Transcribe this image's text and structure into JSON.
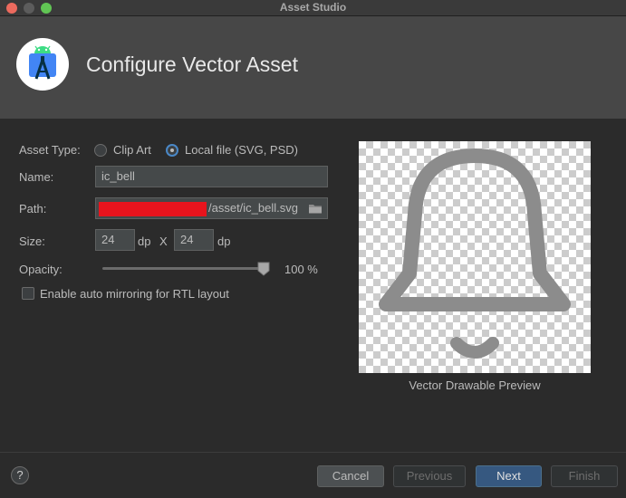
{
  "window": {
    "title": "Asset Studio"
  },
  "header": {
    "title": "Configure Vector Asset"
  },
  "form": {
    "asset_type_label": "Asset Type:",
    "clip_art_label": "Clip Art",
    "local_file_label": "Local file (SVG, PSD)",
    "asset_type_selected": "Local file (SVG, PSD)",
    "name_label": "Name:",
    "name_value": "ic_bell",
    "path_label": "Path:",
    "path_value_visible": "/asset/ic_bell.svg",
    "size_label": "Size:",
    "width_value": "24",
    "width_unit": "dp",
    "size_separator": "X",
    "height_value": "24",
    "height_unit": "dp",
    "opacity_label": "Opacity:",
    "opacity_value": "100 %",
    "opacity_fraction": 1.0,
    "rtl_label": "Enable auto mirroring for RTL layout",
    "rtl_checked": false
  },
  "preview": {
    "caption": "Vector Drawable Preview",
    "icon": "bell-icon",
    "icon_color": "#8c8c8c"
  },
  "footer": {
    "help_label": "?",
    "cancel_label": "Cancel",
    "previous_label": "Previous",
    "next_label": "Next",
    "finish_label": "Finish"
  },
  "colors": {
    "accent": "#4a88c7",
    "primary_button": "#365880",
    "redaction": "#e8141d"
  }
}
